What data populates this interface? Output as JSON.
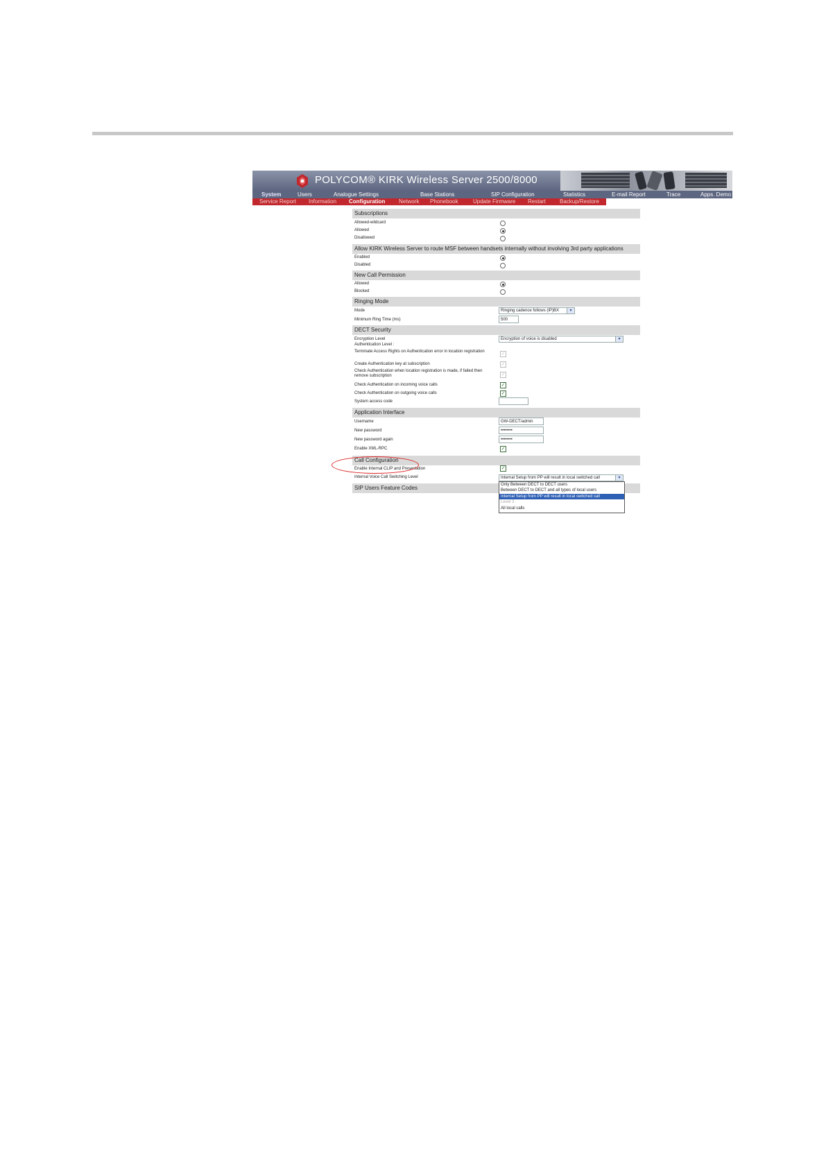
{
  "brand": {
    "title": "POLYCOM® KIRK Wireless Server 2500/8000"
  },
  "menu_primary": [
    "System",
    "Users",
    "Analogue Settings",
    "Base Stations",
    "SIP Configuration",
    "Statistics",
    "E-mail Report",
    "Trace",
    "Apps. Demo"
  ],
  "menu_secondary": [
    "Service Report",
    "Information",
    "Configuration",
    "Network",
    "Phonebook",
    "Update Firmware",
    "Restart",
    "Backup/Restore"
  ],
  "sections": {
    "subscriptions": {
      "title": "Subscriptions",
      "opts": [
        "Allowed-wildcard",
        "Allowed",
        "Disallowed"
      ],
      "selected": "Allowed"
    },
    "msf": {
      "title": "Allow KIRK Wireless Server to route MSF between handsets internally without involving 3rd party applications",
      "opts": [
        "Enabled",
        "Disabled"
      ],
      "selected": "Enabled"
    },
    "new_call": {
      "title": "New Call Permission",
      "opts": [
        "Allowed",
        "Blocked"
      ],
      "selected": "Allowed"
    },
    "ringing": {
      "title": "Ringing Mode",
      "mode_label": "Mode",
      "mode_value": "Ringing cadence follows (IP)BX",
      "min_ring_label": "Minimum Ring Time (ms)",
      "min_ring_value": "500"
    },
    "dect": {
      "title": "DECT Security",
      "enc_label": "Encryption Level",
      "enc_value": "Encryption of voice is disabled",
      "auth_label": "Authentication Level :",
      "items": [
        "Terminate Access Rights on Authentication error in location registration",
        "Create Authentication key at subscription",
        "Check Authentication when location registration is made, if failed then remove subscription",
        "Check Authentication on incoming voice calls",
        "Check Authentication on outgoing voice calls"
      ],
      "access_label": "System access code",
      "access_value": ""
    },
    "app": {
      "title": "Application Interface",
      "user_label": "Username",
      "user_value": "GW-DECT/admin",
      "pw_label": "New password",
      "pw_value": "••••••••",
      "pw2_label": "New password again",
      "pw2_value": "••••••••",
      "xml_label": "Enable XML-RPC"
    },
    "call": {
      "title": "Call Configuration",
      "clip_label": "Enable Internal CLIP and Presentation",
      "switch_label": "Internal Voice Call Switching Level",
      "switch_value": "Internal Setup from PP will result in local switched call",
      "options": [
        "Only Between DECT to DECT users",
        "Between DECT to DECT and all types of local users",
        "Internal Setup from PP will result in local switched call",
        "Level 3",
        "All local calls"
      ]
    },
    "sip": {
      "title": "SIP Users Feature Codes"
    }
  }
}
